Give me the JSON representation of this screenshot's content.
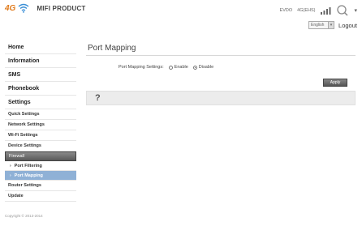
{
  "header": {
    "logo_4g": "4G",
    "product_name": "MIFI PRODUCT",
    "network_type": "EVDO",
    "network_status": "4G(EHS)",
    "language": "English",
    "logout_label": "Logout"
  },
  "icons": {
    "wifi": "wifi-icon",
    "signal": "signal-icon",
    "user": "user-icon",
    "help": "help-icon"
  },
  "sidebar": {
    "items": [
      {
        "label": "Home"
      },
      {
        "label": "Information"
      },
      {
        "label": "SMS"
      },
      {
        "label": "Phonebook"
      },
      {
        "label": "Settings"
      }
    ],
    "settings_items": [
      {
        "label": "Quick Settings"
      },
      {
        "label": "Network Settings"
      },
      {
        "label": "Wi-Fi Settings"
      },
      {
        "label": "Device Settings"
      }
    ],
    "firewall_label": "Firewall",
    "firewall_items": [
      {
        "label": "Port Filtering"
      },
      {
        "label": "Port Mapping"
      }
    ],
    "bottom_items": [
      {
        "label": "Router Settings"
      },
      {
        "label": "Update"
      }
    ]
  },
  "main": {
    "title": "Port Mapping",
    "setting_label": "Port Mapping Settings:",
    "enable_label": "Enable",
    "disable_label": "Disable",
    "selected": "Disable",
    "apply_label": "Apply",
    "help_symbol": "?"
  },
  "footer": {
    "copyright": "Copyright © 2013-2014"
  },
  "colors": {
    "accent_orange": "#e07a1a",
    "wifi_blue": "#3a8fd6",
    "active_nav": "#8fb1d6",
    "section_gray": "#6a6a6a"
  }
}
